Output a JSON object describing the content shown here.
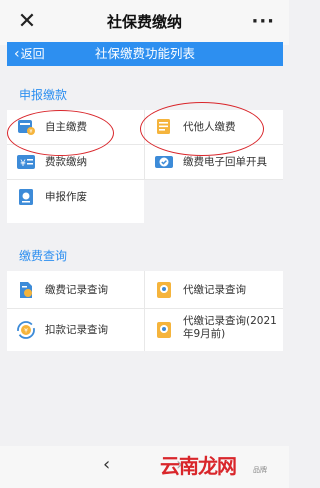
{
  "window": {
    "title": "社保费缴纳",
    "close_glyph": "✕",
    "more_glyph": "···"
  },
  "navbar": {
    "back_label": "返回",
    "title": "社保缴费功能列表"
  },
  "sections": [
    {
      "title": "申报缴款",
      "items": [
        {
          "label": "自主缴费",
          "icon": "self-pay-icon"
        },
        {
          "label": "代他人缴费",
          "icon": "pay-for-others-icon"
        },
        {
          "label": "费款缴纳",
          "icon": "fee-payment-icon"
        },
        {
          "label": "缴费电子回单开具",
          "icon": "e-receipt-icon"
        },
        {
          "label": "申报作废",
          "icon": "declaration-void-icon"
        }
      ]
    },
    {
      "title": "缴费查询",
      "items": [
        {
          "label": "缴费记录查询",
          "icon": "payment-record-icon"
        },
        {
          "label": "代缴记录查询",
          "icon": "proxy-record-icon"
        },
        {
          "label": "扣款记录查询",
          "icon": "deduction-record-icon"
        },
        {
          "label": "代缴记录查询(2021年9月前)",
          "icon": "proxy-record-old-icon"
        }
      ]
    }
  ],
  "bottom": {
    "back_glyph": "‹",
    "forward_glyph": "›"
  },
  "watermark": {
    "text": "云南龙网",
    "small": "品牌"
  },
  "colors": {
    "accent": "#2d8ff0",
    "annotation_red": "#d9262b",
    "background": "#f1f1f3"
  }
}
